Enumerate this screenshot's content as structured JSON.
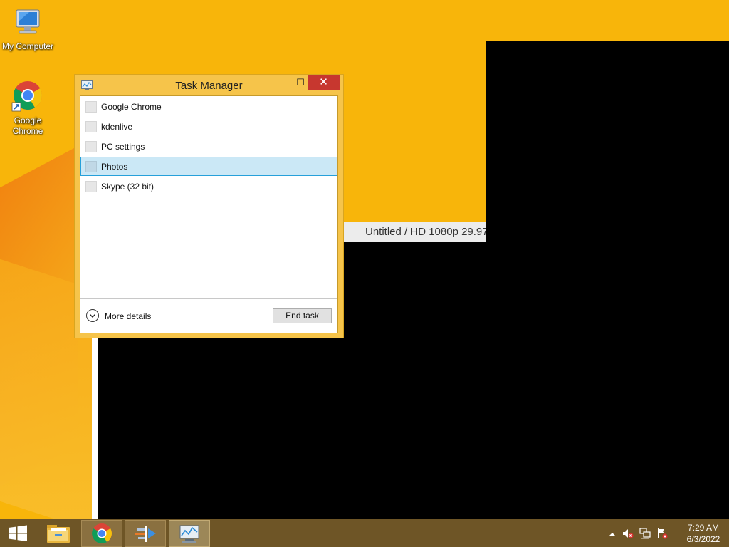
{
  "desktop": {
    "background_color": "#f8b50a",
    "icons": [
      {
        "label": "My Computer",
        "icon": "computer-icon"
      },
      {
        "label": "Google\nChrome",
        "icon": "chrome-icon"
      }
    ]
  },
  "background_window": {
    "title": "Untitled / HD 1080p 29.97"
  },
  "task_manager": {
    "title": "Task Manager",
    "controls": {
      "minimize": "—",
      "maximize": "☐",
      "close": "✕"
    },
    "processes": [
      {
        "name": "Google Chrome",
        "selected": false
      },
      {
        "name": "kdenlive",
        "selected": false
      },
      {
        "name": "PC settings",
        "selected": false
      },
      {
        "name": "Photos",
        "selected": true
      },
      {
        "name": "Skype (32 bit)",
        "selected": false
      }
    ],
    "more_details_label": "More details",
    "end_task_label": "End task",
    "accent_color": "#f6c44a",
    "close_color": "#c7372f",
    "selection_color": "#cbe8f6"
  },
  "taskbar": {
    "background_color": "#6e5526",
    "pinned": [
      "windows-start-icon",
      "file-explorer-icon",
      "chrome-icon",
      "kdenlive-icon",
      "task-manager-icon"
    ],
    "tray": {
      "icons": [
        "show-hidden-icons-chevron",
        "volume-muted-icon",
        "network-icon",
        "action-center-flag-icon"
      ],
      "time": "7:29 AM",
      "date": "6/3/2022"
    }
  }
}
